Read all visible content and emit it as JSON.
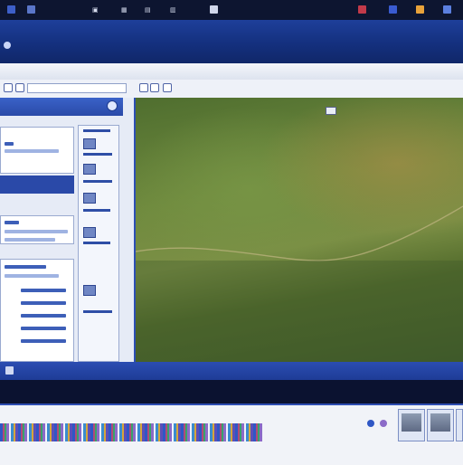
{
  "topbar": {
    "items": [
      "≡",
      "▣",
      "▦",
      "▤",
      "▥"
    ]
  },
  "statusbar": {
    "right_items": [
      "",
      ""
    ]
  },
  "colors": {
    "accent": "#2d4fb4",
    "titlebar": "#14307e",
    "map_green": "#6f8a3e"
  }
}
